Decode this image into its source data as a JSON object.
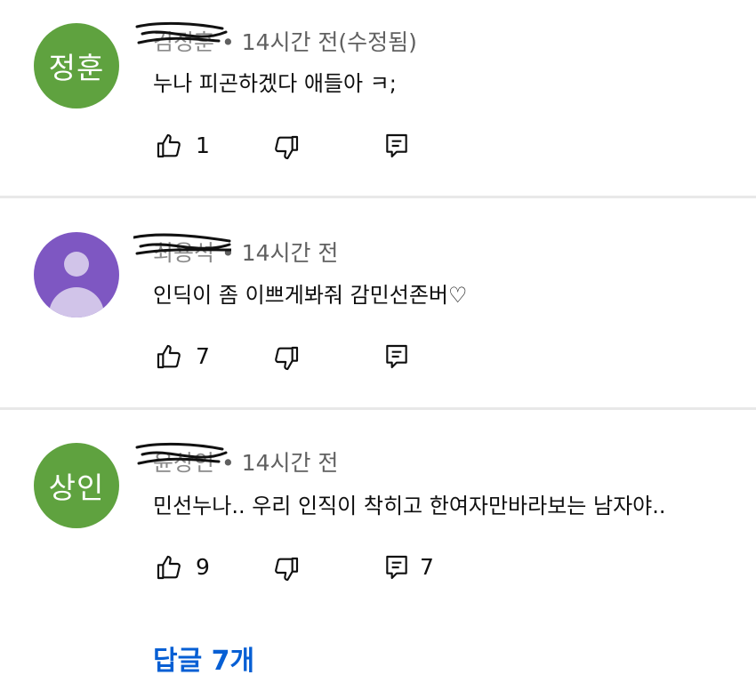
{
  "comments": [
    {
      "avatar_text": "정훈",
      "avatar_color": "#5fa23f",
      "author": "김정훈",
      "separator": "•",
      "time": "14시간 전(수정됨)",
      "text": "누나 피곤하겠다 애들아 ㅋ;",
      "likes": "1",
      "replies": ""
    },
    {
      "avatar_text": "",
      "avatar_color": "#7e57c2",
      "author": "최용석",
      "separator": "•",
      "time": "14시간 전",
      "text": "인딕이 좀 이쁘게봐줘  감민선존버♡",
      "likes": "7",
      "replies": ""
    },
    {
      "avatar_text": "상인",
      "avatar_color": "#5fa23f",
      "author": "윤상인",
      "separator": "•",
      "time": "14시간 전",
      "text": "민선누나.. 우리 인직이 착히고 한여자만바라보는 남자야..",
      "likes": "9",
      "replies": "7"
    }
  ],
  "replies_link": "답글 7개",
  "icons": {
    "like": "thumbs-up-icon",
    "dislike": "thumbs-down-icon",
    "reply": "reply-comment-icon"
  }
}
